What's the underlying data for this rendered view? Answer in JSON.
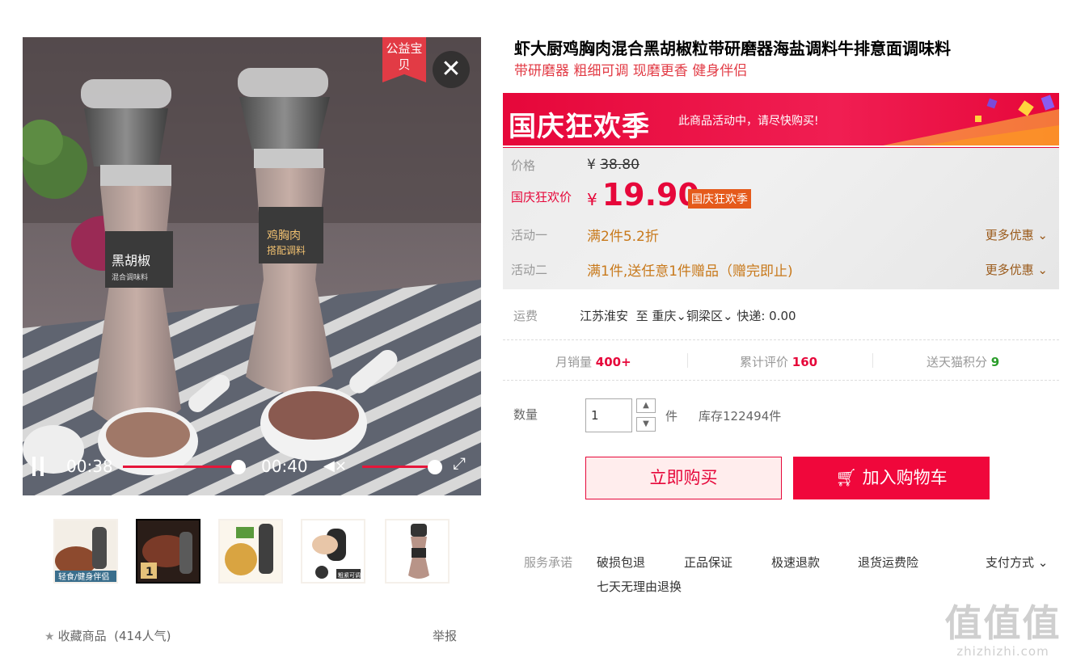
{
  "video": {
    "badge": "公益宝贝",
    "current_time": "00:38",
    "total_time": "00:40",
    "progress": 0.95,
    "volume": 1.0,
    "muted": true,
    "jar_labels": [
      "黑胡椒",
      "混合调味料",
      "鸡胸肉",
      "搭配调料"
    ]
  },
  "thumbnails": [
    {
      "caption": "轻食/健身伴侣",
      "active": false
    },
    {
      "caption": "1",
      "active": true
    },
    {
      "caption": "",
      "active": false
    },
    {
      "caption": "粗紧可调",
      "active": false
    },
    {
      "caption": "",
      "active": false
    }
  ],
  "favorite": {
    "label": "收藏商品",
    "count": "(414人气)"
  },
  "report_label": "举报",
  "product": {
    "title": "虾大厨鸡胸肉混合黑胡椒粒带研磨器海盐调料牛排意面调味料",
    "subtitle": "带研磨器 粗细可调 现磨更香 健身伴侣"
  },
  "banner": {
    "title": "国庆狂欢季",
    "text": "此商品活动中，请尽快购买!"
  },
  "price": {
    "label": "价格",
    "currency": "¥",
    "original": "38.80",
    "promo_label": "国庆狂欢价",
    "promo": "19.90",
    "promo_tag": "国庆狂欢季"
  },
  "activities": [
    {
      "label": "活动一",
      "text": "满2件5.2折",
      "more": "更多优惠"
    },
    {
      "label": "活动二",
      "text": "满1件,送任意1件赠品（赠完即止)",
      "more": "更多优惠"
    }
  ],
  "shipping": {
    "label": "运费",
    "from": "江苏淮安",
    "to_word": "至",
    "city": "重庆",
    "district": "铜梁区",
    "express": "快递: 0.00"
  },
  "stats": [
    {
      "label": "月销量",
      "value": "400+"
    },
    {
      "label": "累计评价",
      "value": "160"
    },
    {
      "label": "送天猫积分",
      "value": "9"
    }
  ],
  "quantity": {
    "label": "数量",
    "value": "1",
    "unit": "件",
    "stock": "库存122494件"
  },
  "buttons": {
    "buy_now": "立即购买",
    "add_cart": "加入购物车"
  },
  "services": {
    "label": "服务承诺",
    "items": [
      "破损包退",
      "正品保证",
      "极速退款",
      "退货运费险",
      "七天无理由退换"
    ],
    "payment": "支付方式"
  },
  "watermark": {
    "big": "值值值",
    "small": "zhizhizhi.com"
  },
  "colors": {
    "accent": "#e6073a",
    "activity": "#c8791b",
    "tag": "#e55a1b"
  }
}
